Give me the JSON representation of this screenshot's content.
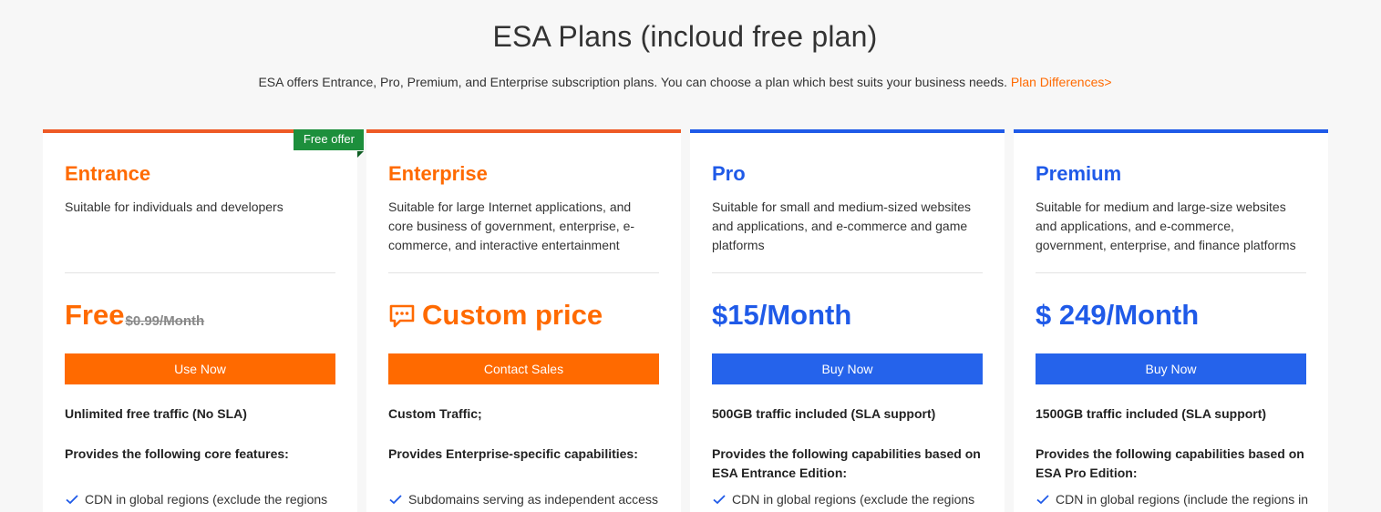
{
  "header": {
    "title": "ESA Plans (incloud free plan)",
    "subtitle": "ESA offers Entrance, Pro, Premium, and Enterprise subscription plans. You can choose a plan which best suits your business needs.",
    "link_label": "Plan Differences>"
  },
  "colors": {
    "orange": "#ff6a00",
    "blue": "#1f5ae8",
    "badge_green": "#1d8f3c"
  },
  "plans": [
    {
      "name": "Entrance",
      "badge": "Free offer",
      "description": "Suitable for individuals and developers",
      "price": "Free",
      "old_price": "$0.99/Month",
      "cta": "Use Now",
      "traffic": "Unlimited free traffic (No SLA)",
      "features_heading": "Provides the following core features:",
      "first_feature": "CDN in global regions (exclude the regions"
    },
    {
      "name": "Enterprise",
      "description": "Suitable for large Internet applications, and core business of government, enterprise, e-commerce, and interactive entertainment",
      "price": "Custom price",
      "price_icon": "chat-bubble-icon",
      "cta": "Contact Sales",
      "traffic": "Custom Traffic;",
      "features_heading": "Provides Enterprise-specific capabilities:",
      "first_feature": "Subdomains serving as independent access"
    },
    {
      "name": "Pro",
      "description": "Suitable for small and medium-sized websites and applications, and e-commerce and game platforms",
      "price": "$15/Month",
      "cta": "Buy Now",
      "traffic": "500GB traffic included (SLA support)",
      "features_heading": "Provides the following capabilities based on ESA Entrance Edition:",
      "first_feature": "CDN in global regions (exclude the regions"
    },
    {
      "name": "Premium",
      "description": "Suitable for medium and large-size websites and applications, and e-commerce, government, enterprise, and finance platforms",
      "price": "$ 249/Month",
      "cta": "Buy Now",
      "traffic": "1500GB traffic included (SLA support)",
      "features_heading": "Provides the following capabilities based on ESA Pro Edition:",
      "first_feature": "CDN in global regions (include the regions in"
    }
  ]
}
